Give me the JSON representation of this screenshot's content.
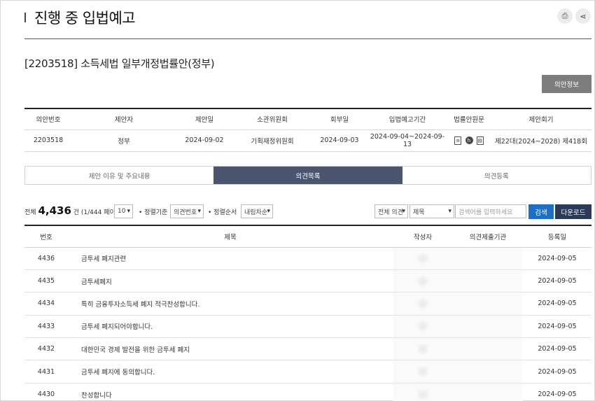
{
  "header": {
    "title": "진행 중 입법예고"
  },
  "bill": {
    "title": "[2203518] 소득세법 일부개정법률안(정부)",
    "info_button": "의안정보"
  },
  "info_table": {
    "headers": [
      "의안번호",
      "제안자",
      "제안일",
      "소관위원회",
      "회부일",
      "입법예고기간",
      "법률안원문",
      "제안회기"
    ],
    "row": {
      "bill_no": "2203518",
      "proposer": "정부",
      "proposal_date": "2024-09-02",
      "committee": "기획재정위원회",
      "referral_date": "2024-09-03",
      "period": "2024-09-04~2024-09-13",
      "session": "제22대(2024~2028) 제418회"
    }
  },
  "tabs": [
    {
      "label": "제안 이유 및 주요내용",
      "active": false
    },
    {
      "label": "의견목록",
      "active": true
    },
    {
      "label": "의견등록",
      "active": false
    }
  ],
  "controls": {
    "total_prefix": "전체",
    "total_count": "4,436",
    "total_suffix": "건 (1/444 페이지)",
    "page_size": "10",
    "sort_key_label": "• 정렬기준",
    "sort_key": "의견번호",
    "sort_order_label": "• 정렬순서",
    "sort_order": "내림차순",
    "scope": "전체 의견",
    "field": "제목",
    "search_placeholder": "검색어를 입력하세요",
    "search_button": "검색",
    "download_button": "다운로드"
  },
  "list": {
    "headers": [
      "번호",
      "제목",
      "작성자",
      "의견제출기관",
      "등록일"
    ],
    "rows": [
      {
        "no": "4436",
        "title": "금투세 폐지관련",
        "date": "2024-09-05"
      },
      {
        "no": "4435",
        "title": "금투세폐지",
        "date": "2024-09-05"
      },
      {
        "no": "4434",
        "title": "특히 금융투자소득세 폐지 적극찬성합니다.",
        "date": "2024-09-05"
      },
      {
        "no": "4433",
        "title": "금투세 폐지되어야합니다.",
        "date": "2024-09-05"
      },
      {
        "no": "4432",
        "title": "대한민국 경제 발전을 위한 금투세 폐지",
        "date": "2024-09-05"
      },
      {
        "no": "4431",
        "title": "금투세 폐지에 동의합니다.",
        "date": "2024-09-05"
      },
      {
        "no": "4430",
        "title": "찬성합니다",
        "date": "2024-09-05"
      }
    ]
  }
}
